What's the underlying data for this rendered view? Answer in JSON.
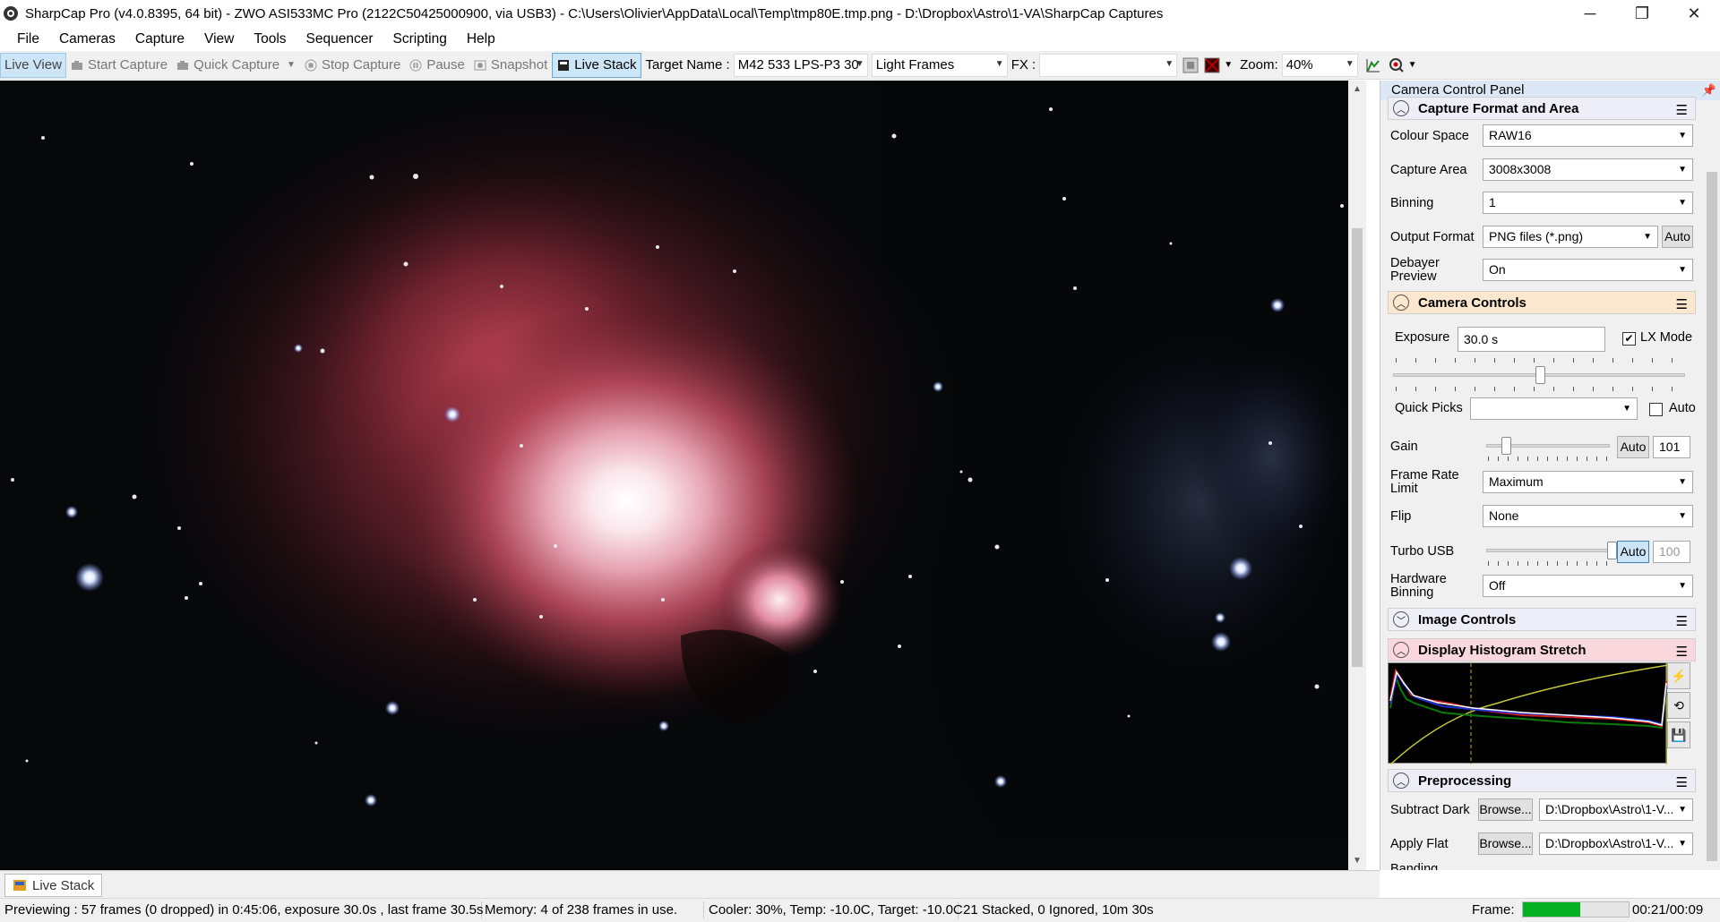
{
  "window": {
    "title": "SharpCap Pro (v4.0.8395, 64 bit) - ZWO ASI533MC Pro (2122C50425000900, via USB3) - C:\\Users\\Olivier\\AppData\\Local\\Temp\\tmp80E.tmp.png - D:\\Dropbox\\Astro\\1-VA\\SharpCap Captures",
    "minimize": "─",
    "restore": "❐",
    "close": "✕"
  },
  "menu": [
    "File",
    "Cameras",
    "Capture",
    "View",
    "Tools",
    "Sequencer",
    "Scripting",
    "Help"
  ],
  "toolbar": {
    "live_view": "Live View",
    "start_capture": "Start Capture",
    "quick_capture": "Quick Capture",
    "stop_capture": "Stop Capture",
    "pause": "Pause",
    "snapshot": "Snapshot",
    "live_stack": "Live Stack",
    "target_label": "Target Name :",
    "target_value": "M42 533 LPS-P3 30",
    "frame_type": "Light Frames",
    "fx_label": "FX :",
    "fx_value": "",
    "zoom_label": "Zoom:",
    "zoom_value": "40%"
  },
  "bottom_tab": "Live Stack",
  "status": {
    "previewing": "Previewing : 57 frames (0 dropped) in 0:45:06, exposure 30.0s , last frame 30.5s",
    "memory": "Memory: 4 of 238 frames in use.",
    "cooler": "Cooler: 30%, Temp: -10.0C, Target: -10.0C",
    "stacked": "21 Stacked, 0 Ignored, 10m 30s",
    "frame_label": "Frame:",
    "frame_progress": 0.55,
    "time": "00:21/00:09"
  },
  "panel": {
    "title": "Camera Control Panel",
    "capture_format": {
      "header": "Capture Format and Area",
      "colour_space_label": "Colour Space",
      "colour_space": "RAW16",
      "capture_area_label": "Capture Area",
      "capture_area": "3008x3008",
      "binning_label": "Binning",
      "binning": "1",
      "output_format_label": "Output Format",
      "output_format": "PNG files (*.png)",
      "output_auto": "Auto",
      "debayer_label_1": "Debayer",
      "debayer_label_2": "Preview",
      "debayer": "On"
    },
    "camera_controls": {
      "header": "Camera Controls",
      "exposure_label": "Exposure",
      "exposure": "30.0 s",
      "lx_mode": "LX Mode",
      "quick_picks_label": "Quick Picks",
      "quick_picks_auto": "Auto",
      "gain_label": "Gain",
      "gain_auto": "Auto",
      "gain": "101",
      "frame_rate_label_1": "Frame Rate",
      "frame_rate_label_2": "Limit",
      "frame_rate": "Maximum",
      "flip_label": "Flip",
      "flip": "None",
      "turbo_label": "Turbo USB",
      "turbo_auto": "Auto",
      "turbo": "100",
      "hw_binning_label_1": "Hardware",
      "hw_binning_label_2": "Binning",
      "hw_binning": "Off"
    },
    "image_controls": {
      "header": "Image Controls"
    },
    "histogram": {
      "header": "Display Histogram Stretch"
    },
    "preprocessing": {
      "header": "Preprocessing",
      "dark_label": "Subtract Dark",
      "dark_browse": "Browse...",
      "dark_path": "D:\\Dropbox\\Astro\\1-V...",
      "flat_label": "Apply Flat",
      "flat_browse": "Browse...",
      "flat_path": "D:\\Dropbox\\Astro\\1-V...",
      "banding_label": "Banding"
    }
  },
  "colors": {
    "accent": "#cde6f7",
    "histogram_header": "#f9d7dc",
    "camera_header": "#fbe7cd",
    "progress": "#06b025"
  }
}
